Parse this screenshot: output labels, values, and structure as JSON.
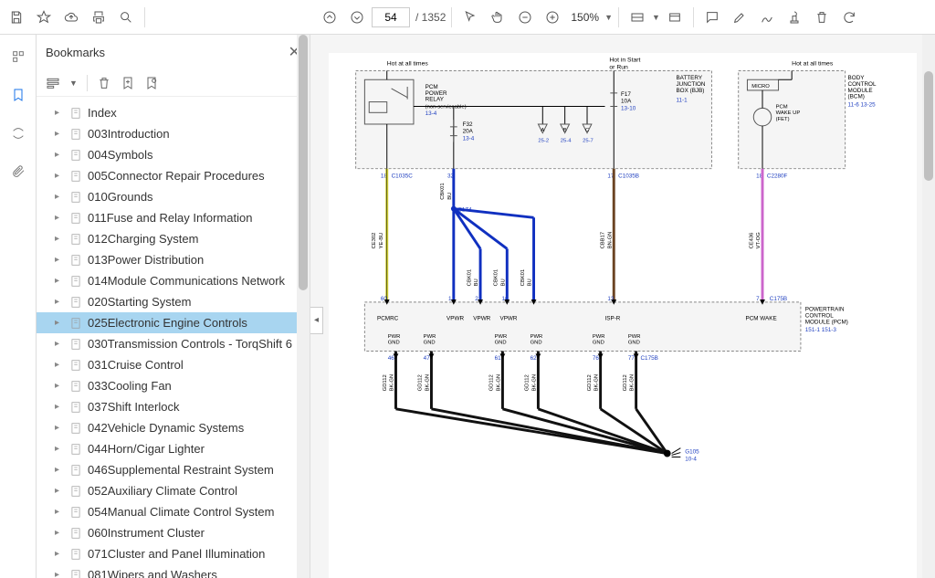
{
  "toolbar": {
    "page_current": "54",
    "page_total": "/ 1352",
    "zoom": "150%"
  },
  "panel": {
    "title": "Bookmarks"
  },
  "bookmarks": [
    {
      "label": "Index",
      "sel": false
    },
    {
      "label": "003Introduction",
      "sel": false
    },
    {
      "label": "004Symbols",
      "sel": false
    },
    {
      "label": "005Connector Repair Procedures",
      "sel": false
    },
    {
      "label": "010Grounds",
      "sel": false
    },
    {
      "label": "011Fuse and Relay Information",
      "sel": false
    },
    {
      "label": "012Charging System",
      "sel": false
    },
    {
      "label": "013Power Distribution",
      "sel": false
    },
    {
      "label": "014Module Communications Network",
      "sel": false
    },
    {
      "label": "020Starting System",
      "sel": false
    },
    {
      "label": "025Electronic Engine Controls",
      "sel": true
    },
    {
      "label": "030Transmission Controls - TorqShift 6",
      "sel": false
    },
    {
      "label": "031Cruise Control",
      "sel": false
    },
    {
      "label": "033Cooling Fan",
      "sel": false
    },
    {
      "label": "037Shift Interlock",
      "sel": false
    },
    {
      "label": "042Vehicle Dynamic Systems",
      "sel": false
    },
    {
      "label": "044Horn/Cigar Lighter",
      "sel": false
    },
    {
      "label": "046Supplemental Restraint System",
      "sel": false
    },
    {
      "label": "052Auxiliary Climate Control",
      "sel": false
    },
    {
      "label": "054Manual Climate Control System",
      "sel": false
    },
    {
      "label": "060Instrument Cluster",
      "sel": false
    },
    {
      "label": "071Cluster and Panel Illumination",
      "sel": false
    },
    {
      "label": "081Wipers and Washers",
      "sel": false
    }
  ],
  "diagram": {
    "hot_all_1": "Hot at all times",
    "hot_start": "Hot in Start or Run",
    "hot_all_2": "Hot at all times",
    "bjb": {
      "title": "BATTERY JUNCTION BOX (BJB)",
      "ref": "11-1"
    },
    "bcm": {
      "title": "BODY CONTROL MODULE (BCM)",
      "ref": "11-6 13-25"
    },
    "pcm_relay": {
      "title": "PCM POWER RELAY",
      "sub": "(non-serviceable)",
      "ref": "13-4"
    },
    "micro": "MICRO",
    "pcm_wakeup": "PCM WAKE UP (FET)",
    "fuse_f32": {
      "label": "F32",
      "amp": "20A",
      "ref": "13-4"
    },
    "fuse_f17": {
      "label": "F17",
      "amp": "10A",
      "ref": "13-10"
    },
    "refs_abc": {
      "a": "25-2",
      "b": "25-4",
      "c": "25-7"
    },
    "conn_c1035c": {
      "pin": "18",
      "name": "C1035C"
    },
    "conn_c1035c_32": {
      "pin": "32"
    },
    "conn_c1035b": {
      "pin": "17",
      "name": "C1035B"
    },
    "conn_c2280f": {
      "pin": "18",
      "name": "C2280F"
    },
    "s174": "S174",
    "wire_ce302": {
      "id": "CE302",
      "color": "YE-BU"
    },
    "wire_cbk01": {
      "id": "CBK01",
      "color": "BU"
    },
    "wire_cbb17": {
      "id": "CBB17",
      "color": "BN-GN"
    },
    "wire_ce436": {
      "id": "CE436",
      "color": "VT-OG"
    },
    "wire_gd112": {
      "id": "GD112",
      "color": "BK-GN"
    },
    "pcm_box": {
      "title": "POWERTRAIN CONTROL MODULE (PCM)",
      "ref": "151-1 151-3"
    },
    "pcm_pins_top": {
      "p60": "60",
      "p1": "1",
      "p2": "2",
      "p16": "16",
      "p13": "13",
      "p7": "7",
      "c175b": "C175B"
    },
    "pcm_labels": {
      "pcmrc": "PCMRC",
      "vpwr": "VPWR",
      "ispr": "ISP-R",
      "pcmwake": "PCM WAKE",
      "pwrgnd": "PWR GND"
    },
    "pcm_pins_bot": {
      "p46": "46",
      "p47": "47",
      "p61": "61",
      "p62": "62",
      "p76": "76",
      "p77": "77",
      "c175b": "C175B"
    },
    "g105": {
      "name": "G105",
      "ref": "10-4"
    }
  }
}
